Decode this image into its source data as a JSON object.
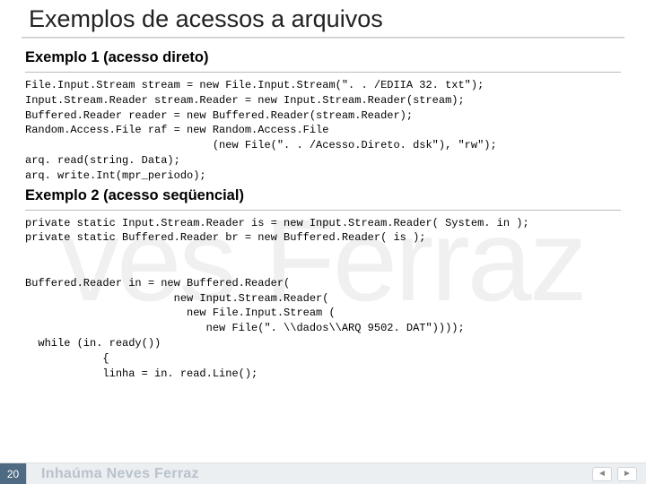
{
  "watermark_text": "ves Ferraz",
  "title": "Exemplos de acessos a arquivos",
  "section1": {
    "heading": "Exemplo 1 (acesso direto)",
    "code": "File.Input.Stream stream = new File.Input.Stream(\". . /EDIIA 32. txt\");\nInput.Stream.Reader stream.Reader = new Input.Stream.Reader(stream);\nBuffered.Reader reader = new Buffered.Reader(stream.Reader);\nRandom.Access.File raf = new Random.Access.File\n                             (new File(\". . /Acesso.Direto. dsk\"), \"rw\");\narq. read(string. Data);\narq. write.Int(mpr_periodo);"
  },
  "section2": {
    "heading": "Exemplo 2 (acesso seqüencial)",
    "code": "private static Input.Stream.Reader is = new Input.Stream.Reader( System. in );\nprivate static Buffered.Reader br = new Buffered.Reader( is );\n\n\nBuffered.Reader in = new Buffered.Reader(\n                       new Input.Stream.Reader(\n                         new File.Input.Stream (\n                            new File(\". \\\\dados\\\\ARQ 9502. DAT\"))));\n  while (in. ready())\n            {\n            linha = in. read.Line();"
  },
  "footer": {
    "page": "20",
    "name": "Inhaúma Neves Ferraz",
    "nav_prev": "◄",
    "nav_next": "►"
  }
}
